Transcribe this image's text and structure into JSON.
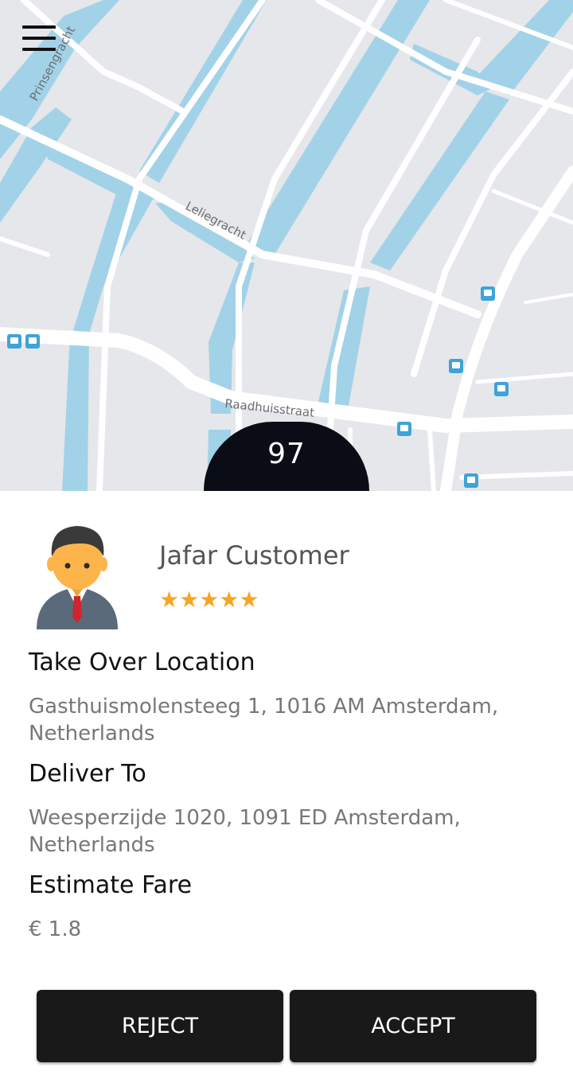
{
  "map": {
    "street_labels": [
      "Prinsengracht",
      "Leliegracht",
      "Raadhuisstraat"
    ],
    "timer_value": "97",
    "colors": {
      "water": "#a2d2e8",
      "land": "#e6e7ea",
      "road": "#ffffff",
      "transit": "#3fa3d8"
    }
  },
  "customer": {
    "name": "Jafar Customer",
    "rating": 5,
    "stars": "★★★★★"
  },
  "trip": {
    "pickup_label": "Take Over Location",
    "pickup_address": "Gasthuismolensteeg 1, 1016 AM Amsterdam, Netherlands",
    "dropoff_label": "Deliver To",
    "dropoff_address": "Weesperzijde 1020, 1091 ED Amsterdam, Netherlands",
    "fare_label": "Estimate Fare",
    "fare_value": "€ 1.8"
  },
  "actions": {
    "reject_label": "REJECT",
    "accept_label": "ACCEPT"
  },
  "icons": [
    "menu-icon",
    "customer-avatar-icon",
    "star-icon",
    "transit-stop-icon"
  ]
}
